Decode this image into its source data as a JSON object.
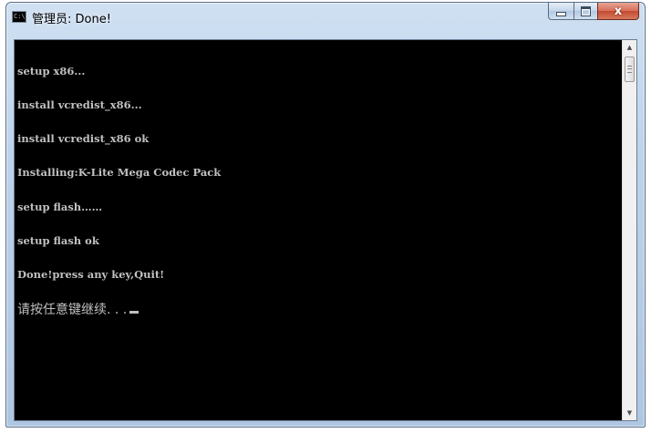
{
  "window": {
    "title": "管理员: Done!",
    "icon": "console-icon",
    "icon_text": "C:\\"
  },
  "caption_buttons": {
    "minimize": "minimize-icon",
    "maximize": "maximize-icon",
    "close": "close-icon",
    "close_glyph": "x"
  },
  "console": {
    "lines": [
      "setup x86...",
      "install vcredist_x86...",
      "install vcredist_x86 ok",
      "Installing:K-Lite Mega Codec Pack",
      "setup flash……",
      "setup flash ok",
      "Done!press any key,Quit!"
    ],
    "prompt": "请按任意键继续. . ."
  },
  "scrollbar": {
    "up_glyph": "▲",
    "down_glyph": "▼"
  },
  "colors": {
    "console_bg": "#000000",
    "console_fg": "#c0c0c0",
    "close_button": "#c34a2f"
  }
}
